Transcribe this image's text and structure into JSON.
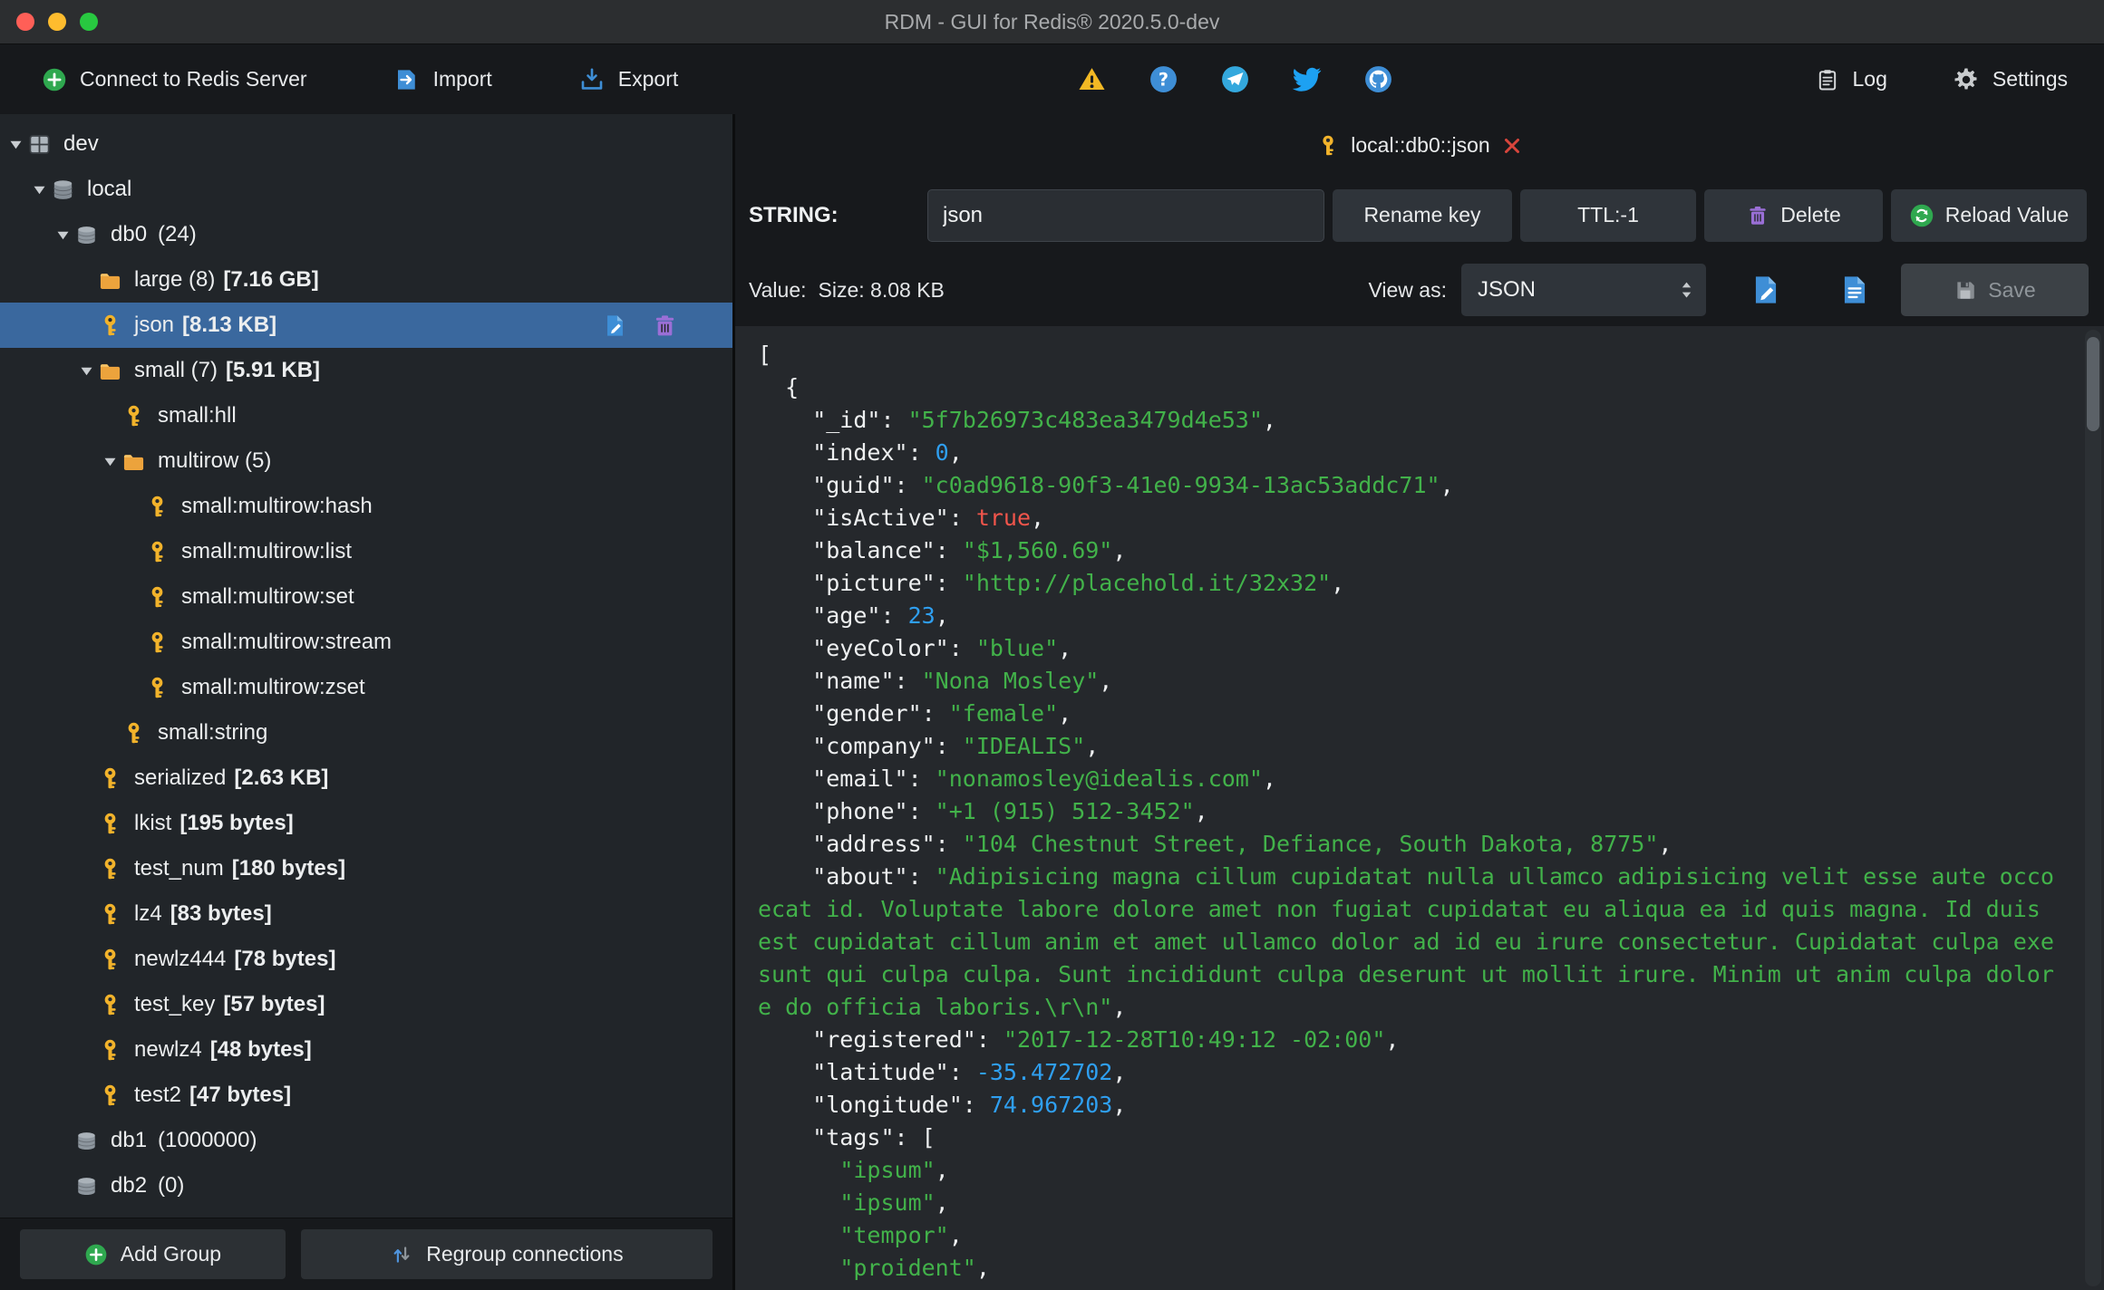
{
  "window": {
    "title": "RDM - GUI for Redis® 2020.5.0-dev"
  },
  "toolbar": {
    "connect": "Connect to Redis Server",
    "import": "Import",
    "export": "Export",
    "log": "Log",
    "settings": "Settings"
  },
  "icons": {
    "connect": "plus-circle",
    "import": "import-doc",
    "export": "export-tray",
    "status": [
      "warning",
      "help",
      "telegram",
      "twitter",
      "github"
    ],
    "log": "clipboard",
    "settings": "gear",
    "tab_key": "key",
    "tab_close": "close-x",
    "delete": "trash",
    "reload": "refresh",
    "doc_edit": "doc-edit",
    "doc_text": "doc-text",
    "save": "floppy",
    "add_group": "plus-circle",
    "regroup": "arrows-up-down",
    "dropdown": "spinner"
  },
  "colors": {
    "selection": "#3a689e",
    "key_icon": "#f2b32b",
    "folder_icon": "#eca33c",
    "accent_green": "#2fa84f",
    "accent_blue": "#3e8ed6",
    "trash_purple": "#9a6fd6",
    "close_red": "#d9453c"
  },
  "sidebar": {
    "add_group": "Add Group",
    "regroup": "Regroup connections",
    "tree": [
      {
        "level": 0,
        "icon": "server-grid",
        "label": "dev",
        "expanded": true
      },
      {
        "level": 1,
        "icon": "db-stack",
        "label": "local",
        "expanded": true
      },
      {
        "level": 2,
        "icon": "db",
        "label": "db0",
        "count": "(24)",
        "expanded": true
      },
      {
        "level": 3,
        "icon": "folder",
        "label": "large (8)",
        "size": "[7.16 GB]"
      },
      {
        "level": 3,
        "icon": "key",
        "label": "json",
        "size": "[8.13 KB]",
        "selected": true,
        "actions": [
          "doc-edit",
          "trash"
        ]
      },
      {
        "level": 3,
        "icon": "folder",
        "label": "small (7)",
        "size": "[5.91 KB]",
        "expanded": true
      },
      {
        "level": 4,
        "icon": "key",
        "label": "small:hll"
      },
      {
        "level": 4,
        "icon": "folder",
        "label": "multirow (5)",
        "expanded": true
      },
      {
        "level": 5,
        "icon": "key",
        "label": "small:multirow:hash"
      },
      {
        "level": 5,
        "icon": "key",
        "label": "small:multirow:list"
      },
      {
        "level": 5,
        "icon": "key",
        "label": "small:multirow:set"
      },
      {
        "level": 5,
        "icon": "key",
        "label": "small:multirow:stream"
      },
      {
        "level": 5,
        "icon": "key",
        "label": "small:multirow:zset"
      },
      {
        "level": 4,
        "icon": "key",
        "label": "small:string"
      },
      {
        "level": 3,
        "icon": "key",
        "label": "serialized",
        "size": "[2.63 KB]"
      },
      {
        "level": 3,
        "icon": "key",
        "label": "lkist",
        "size": "[195 bytes]"
      },
      {
        "level": 3,
        "icon": "key",
        "label": "test_num",
        "size": "[180 bytes]"
      },
      {
        "level": 3,
        "icon": "key",
        "label": "lz4",
        "size": "[83 bytes]"
      },
      {
        "level": 3,
        "icon": "key",
        "label": "newlz444",
        "size": "[78 bytes]"
      },
      {
        "level": 3,
        "icon": "key",
        "label": "test_key",
        "size": "[57 bytes]"
      },
      {
        "level": 3,
        "icon": "key",
        "label": "newlz4",
        "size": "[48 bytes]"
      },
      {
        "level": 3,
        "icon": "key",
        "label": "test2",
        "size": "[47 bytes]"
      },
      {
        "level": 2,
        "icon": "db",
        "label": "db1",
        "count": "(1000000)"
      },
      {
        "level": 2,
        "icon": "db",
        "label": "db2",
        "count": "(0)"
      }
    ]
  },
  "editor": {
    "tab_label": "local::db0::json",
    "type_label": "STRING:",
    "key_name": "json",
    "rename_button": "Rename key",
    "ttl_button": "TTL:-1",
    "delete_button": "Delete",
    "reload_button": "Reload Value",
    "value_label": "Value:",
    "size_label": "Size: 8.08 KB",
    "view_as_label": "View as:",
    "view_format": "JSON",
    "save_button": "Save"
  },
  "json_viewer": {
    "colors": {
      "plain": "#eef0f1",
      "string": "#42b24a",
      "number": "#2f9ff0",
      "bool": "#f2554b"
    },
    "lines": [
      [
        {
          "t": "["
        }
      ],
      [
        {
          "t": "  {"
        }
      ],
      [
        {
          "t": "    \"_id\": "
        },
        {
          "t": "\"5f7b26973c483ea3479d4e53\"",
          "c": "s"
        },
        {
          "t": ","
        }
      ],
      [
        {
          "t": "    \"index\": "
        },
        {
          "t": "0",
          "c": "n"
        },
        {
          "t": ","
        }
      ],
      [
        {
          "t": "    \"guid\": "
        },
        {
          "t": "\"c0ad9618-90f3-41e0-9934-13ac53addc71\"",
          "c": "s"
        },
        {
          "t": ","
        }
      ],
      [
        {
          "t": "    \"isActive\": "
        },
        {
          "t": "true",
          "c": "b"
        },
        {
          "t": ","
        }
      ],
      [
        {
          "t": "    \"balance\": "
        },
        {
          "t": "\"$1,560.69\"",
          "c": "s"
        },
        {
          "t": ","
        }
      ],
      [
        {
          "t": "    \"picture\": "
        },
        {
          "t": "\"http://placehold.it/32x32\"",
          "c": "s"
        },
        {
          "t": ","
        }
      ],
      [
        {
          "t": "    \"age\": "
        },
        {
          "t": "23",
          "c": "n"
        },
        {
          "t": ","
        }
      ],
      [
        {
          "t": "    \"eyeColor\": "
        },
        {
          "t": "\"blue\"",
          "c": "s"
        },
        {
          "t": ","
        }
      ],
      [
        {
          "t": "    \"name\": "
        },
        {
          "t": "\"Nona Mosley\"",
          "c": "s"
        },
        {
          "t": ","
        }
      ],
      [
        {
          "t": "    \"gender\": "
        },
        {
          "t": "\"female\"",
          "c": "s"
        },
        {
          "t": ","
        }
      ],
      [
        {
          "t": "    \"company\": "
        },
        {
          "t": "\"IDEALIS\"",
          "c": "s"
        },
        {
          "t": ","
        }
      ],
      [
        {
          "t": "    \"email\": "
        },
        {
          "t": "\"nonamosley@idealis.com\"",
          "c": "s"
        },
        {
          "t": ","
        }
      ],
      [
        {
          "t": "    \"phone\": "
        },
        {
          "t": "\"+1 (915) 512-3452\"",
          "c": "s"
        },
        {
          "t": ","
        }
      ],
      [
        {
          "t": "    \"address\": "
        },
        {
          "t": "\"104 Chestnut Street, Defiance, South Dakota, 8775\"",
          "c": "s"
        },
        {
          "t": ","
        }
      ],
      [
        {
          "t": "    \"about\": "
        },
        {
          "t": "\"Adipisicing magna cillum cupidatat nulla ullamco adipisicing velit esse aute occo",
          "c": "s"
        }
      ],
      [
        {
          "t": "ecat id. Voluptate labore dolore amet non fugiat cupidatat eu aliqua ea id quis magna. Id duis ",
          "c": "s"
        }
      ],
      [
        {
          "t": "est cupidatat cillum anim et amet ullamco dolor ad id eu irure consectetur. Cupidatat culpa exe",
          "c": "s"
        }
      ],
      [
        {
          "t": "sunt qui culpa culpa. Sunt incididunt culpa deserunt ut mollit irure. Minim ut anim culpa dolor",
          "c": "s"
        }
      ],
      [
        {
          "t": "e do officia laboris.\\r\\n\"",
          "c": "s"
        },
        {
          "t": ","
        }
      ],
      [
        {
          "t": "    \"registered\": "
        },
        {
          "t": "\"2017-12-28T10:49:12 -02:00\"",
          "c": "s"
        },
        {
          "t": ","
        }
      ],
      [
        {
          "t": "    \"latitude\": "
        },
        {
          "t": "-35.472702",
          "c": "n"
        },
        {
          "t": ","
        }
      ],
      [
        {
          "t": "    \"longitude\": "
        },
        {
          "t": "74.967203",
          "c": "n"
        },
        {
          "t": ","
        }
      ],
      [
        {
          "t": "    \"tags\": ["
        }
      ],
      [
        {
          "t": "      "
        },
        {
          "t": "\"ipsum\"",
          "c": "s"
        },
        {
          "t": ","
        }
      ],
      [
        {
          "t": "      "
        },
        {
          "t": "\"ipsum\"",
          "c": "s"
        },
        {
          "t": ","
        }
      ],
      [
        {
          "t": "      "
        },
        {
          "t": "\"tempor\"",
          "c": "s"
        },
        {
          "t": ","
        }
      ],
      [
        {
          "t": "      "
        },
        {
          "t": "\"proident\"",
          "c": "s"
        },
        {
          "t": ","
        }
      ]
    ]
  }
}
